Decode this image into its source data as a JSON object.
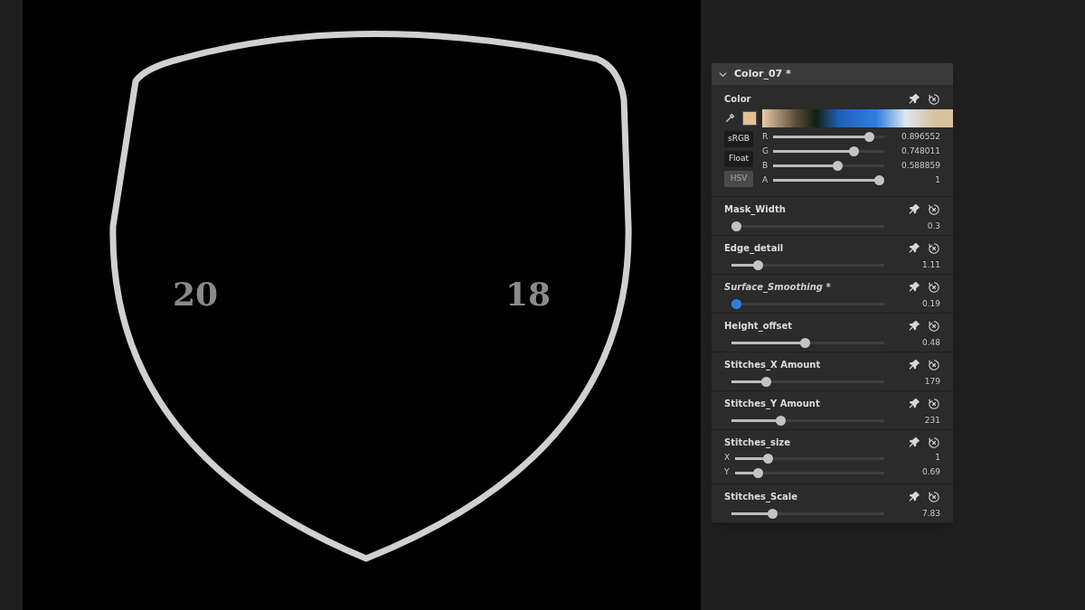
{
  "viewport": {
    "labels": [
      "20",
      "18"
    ]
  },
  "panel": {
    "title": "Color_07 *",
    "expanded": true,
    "params": [
      {
        "kind": "color",
        "name": "Color",
        "modes": [
          {
            "label": "sRGB",
            "selected": false
          },
          {
            "label": "Float",
            "selected": false
          },
          {
            "label": "HSV",
            "selected": true
          }
        ],
        "channels": [
          {
            "label": "R",
            "level": 0.9,
            "reading": "0.896552"
          },
          {
            "label": "G",
            "level": 0.75,
            "reading": "0.748011"
          },
          {
            "label": "B",
            "level": 0.59,
            "reading": "0.588859"
          },
          {
            "label": "A",
            "level": 1,
            "reading": "1"
          }
        ]
      },
      {
        "kind": "slider",
        "name": "Mask_Width",
        "modified": false,
        "level": 0.0,
        "reading": "0.3"
      },
      {
        "kind": "slider",
        "name": "Edge_detail",
        "modified": false,
        "level": 0.15,
        "reading": "1.11"
      },
      {
        "kind": "slider",
        "name": "Surface_Smoothing *",
        "modified": true,
        "level": 0.0,
        "reading": "0.19"
      },
      {
        "kind": "slider",
        "name": "Height_offset",
        "modified": false,
        "level": 0.48,
        "reading": "0.48"
      },
      {
        "kind": "slider",
        "name": "Stitches_X Amount",
        "modified": false,
        "level": 0.21,
        "reading": "179"
      },
      {
        "kind": "slider",
        "name": "Stitches_Y Amount",
        "modified": false,
        "level": 0.31,
        "reading": "231"
      },
      {
        "kind": "vector",
        "name": "Stitches_size",
        "modified": false,
        "components": [
          {
            "label": "X",
            "level": 0.2,
            "reading": "1"
          },
          {
            "label": "Y",
            "level": 0.13,
            "reading": "0.69"
          }
        ]
      },
      {
        "kind": "slider",
        "name": "Stitches_Scale",
        "modified": false,
        "level": 0.25,
        "reading": "7.83"
      }
    ]
  }
}
